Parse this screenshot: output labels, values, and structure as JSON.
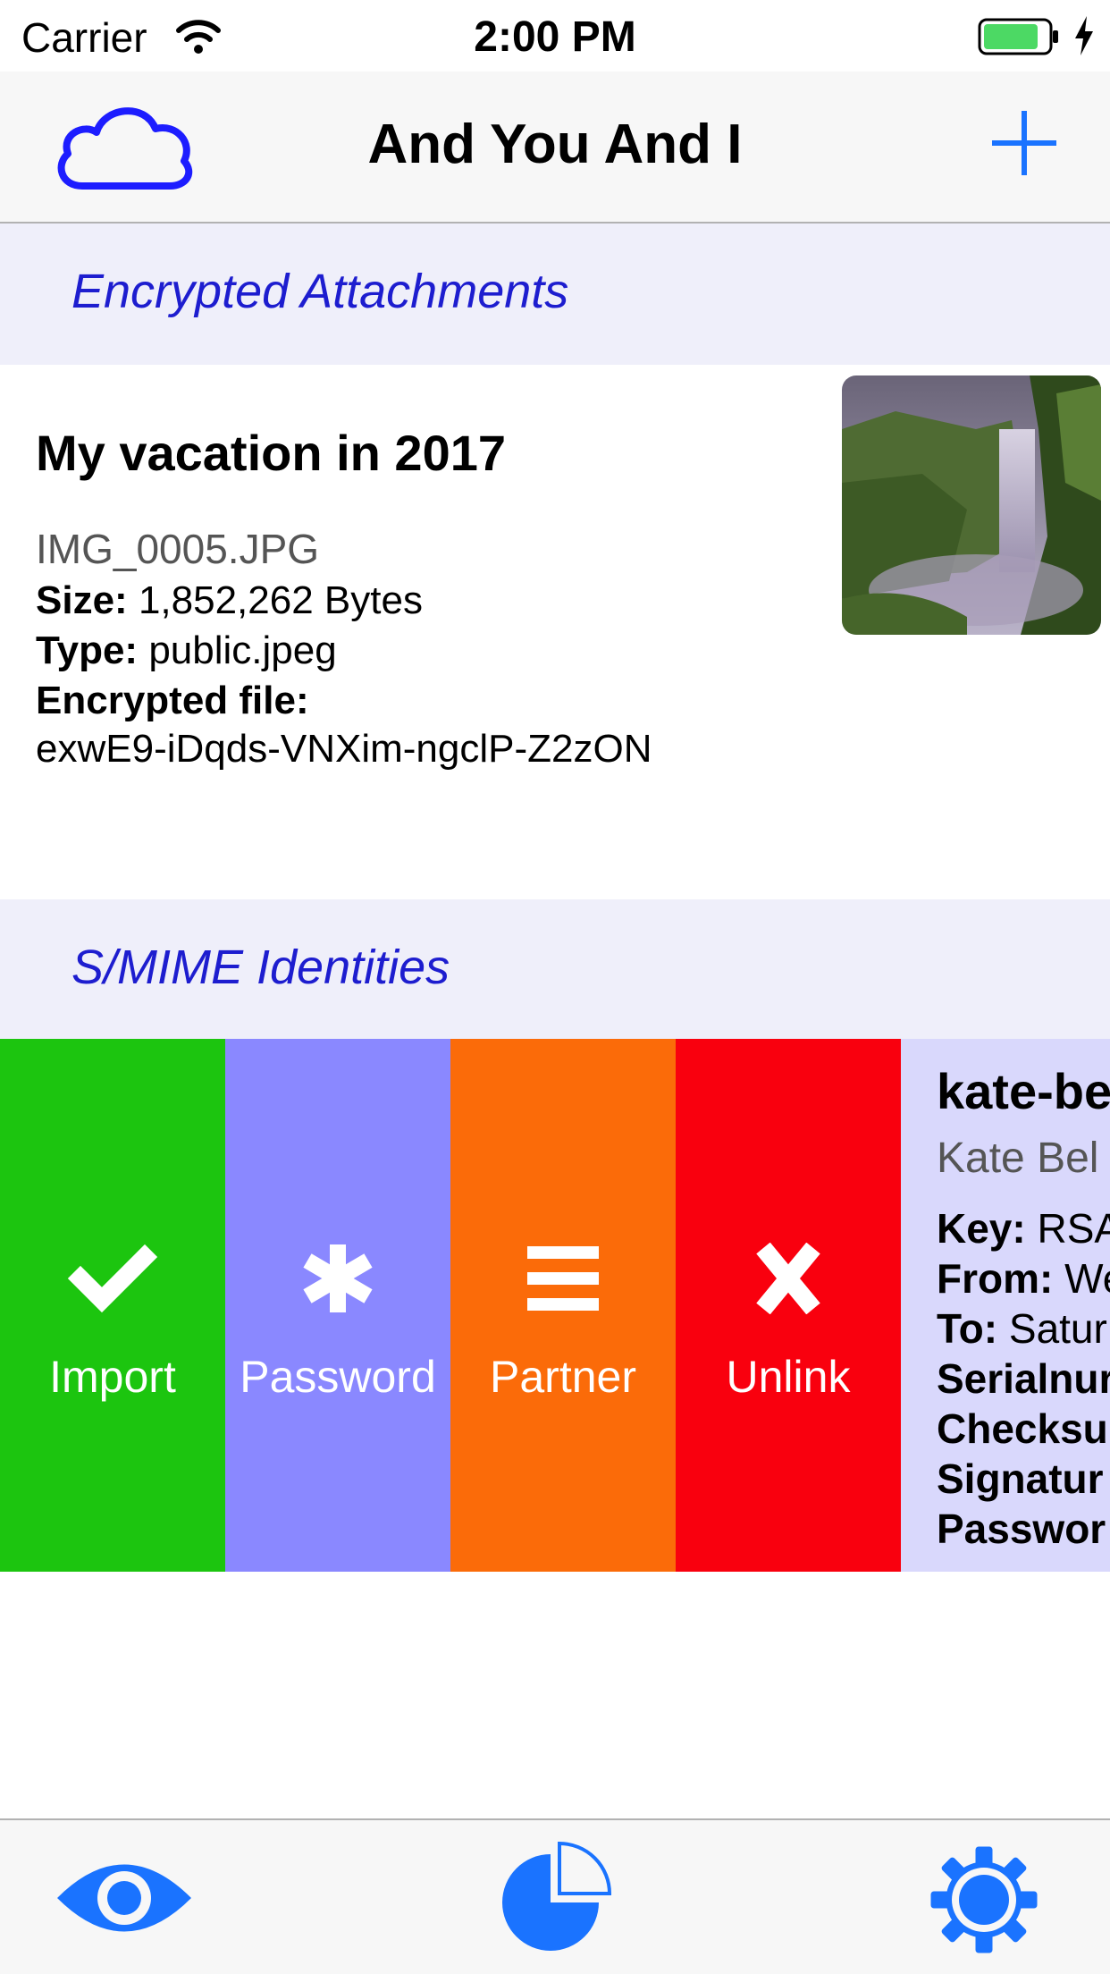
{
  "status_bar": {
    "carrier": "Carrier",
    "time": "2:00 PM"
  },
  "nav": {
    "title": "And You And I",
    "left_icon": "cloud-icon",
    "right_icon": "plus-icon"
  },
  "sections": {
    "attachments_title": "Encrypted Attachments",
    "identities_title": "S/MIME Identities"
  },
  "attachment": {
    "title": "My vacation in 2017",
    "filename": "IMG_0005.JPG",
    "size_label": "Size:",
    "size_value": "1,852,262 Bytes",
    "type_label": "Type:",
    "type_value": "public.jpeg",
    "encrypted_label": "Encrypted file:",
    "encrypted_value": "exwE9-iDqds-VNXim-ngclP-Z2zON",
    "thumbnail": "waterfall-photo"
  },
  "actions": {
    "import": "Import",
    "password": "Password",
    "partner": "Partner",
    "unlink": "Unlink",
    "colors": {
      "import": "#1cc50f",
      "password": "#8a88ff",
      "partner": "#fb6b09",
      "unlink": "#f9000e"
    }
  },
  "identity": {
    "name": "kate-be",
    "fullname": "Kate Bel",
    "key_label": "Key:",
    "key_value": "RSA",
    "from_label": "From:",
    "from_value": "We",
    "to_label": "To:",
    "to_value": "Satur",
    "serial_label": "Serialnur",
    "checksum_label": "Checksu",
    "signature_label": "Signatur",
    "password_label": "Passwor"
  },
  "tab_bar": {
    "icons": [
      "eye-icon",
      "pie-chart-icon",
      "gear-icon"
    ],
    "accent": "#1a73ff"
  },
  "colors": {
    "link_blue": "#1d1dcf",
    "tint": "#1a73ff"
  }
}
